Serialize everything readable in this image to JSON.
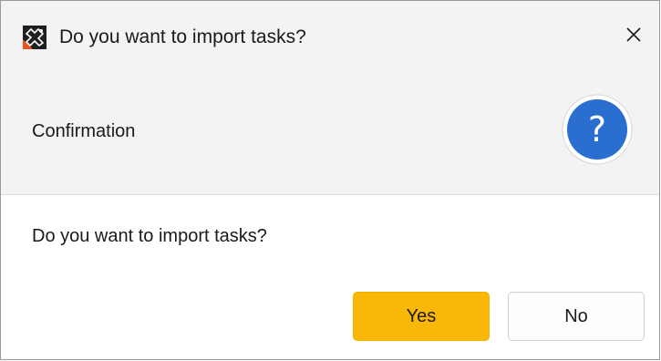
{
  "window": {
    "title": "Do you want to import tasks?",
    "app_icon": "app-logo-icon",
    "close_icon": "close-icon"
  },
  "header": {
    "label": "Confirmation",
    "icon": "question-icon"
  },
  "body": {
    "message": "Do you want to import tasks?"
  },
  "buttons": {
    "yes_label": "Yes",
    "no_label": "No"
  },
  "colors": {
    "accent_yes": "#f9b807",
    "question_icon_blue": "#2a6fd0",
    "header_bg": "#f3f3f3"
  }
}
